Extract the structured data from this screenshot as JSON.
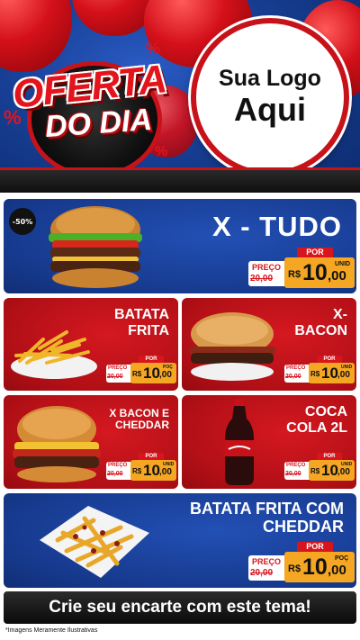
{
  "header": {
    "badge_line1": "OFERTA",
    "badge_line2": "DO DIA",
    "logo_line1": "Sua Logo",
    "logo_line2": "Aqui"
  },
  "products": [
    {
      "name": "X - TUDO",
      "discount": "-50%",
      "por": "POR",
      "preco": "PREÇO",
      "old_price": "20,00",
      "currency": "R$",
      "price_int": "10",
      "price_cents": ",00",
      "unit": "UNID"
    },
    {
      "name": "BATATA\nFRITA",
      "por": "POR",
      "preco": "PREÇO",
      "old_price": "20,00",
      "currency": "R$",
      "price_int": "10",
      "price_cents": ",00",
      "unit": "POÇ"
    },
    {
      "name": "X-\nBACON",
      "por": "POR",
      "preco": "PREÇO",
      "old_price": "20,00",
      "currency": "R$",
      "price_int": "10",
      "price_cents": ",00",
      "unit": "UNID"
    },
    {
      "name": "X BACON E\nCHEDDAR",
      "por": "POR",
      "preco": "PREÇO",
      "old_price": "20,00",
      "currency": "R$",
      "price_int": "10",
      "price_cents": ",00",
      "unit": "UNID"
    },
    {
      "name": "COCA\nCOLA 2L",
      "por": "POR",
      "preco": "PREÇO",
      "old_price": "20,00",
      "currency": "R$",
      "price_int": "10",
      "price_cents": ",00",
      "unit": "UNID"
    },
    {
      "name": "BATATA FRITA COM\nCHEDDAR",
      "por": "POR",
      "preco": "PREÇO",
      "old_price": "20,00",
      "currency": "R$",
      "price_int": "10",
      "price_cents": ",00",
      "unit": "POÇ"
    }
  ],
  "cta": "Crie seu encarte com este tema!",
  "disclaimer": "*Imagens Meramente Ilustrativas",
  "colors": {
    "red": "#d51820",
    "blue": "#163a8e",
    "tag_orange": "#f5a623",
    "dark": "#0d0d0d"
  }
}
